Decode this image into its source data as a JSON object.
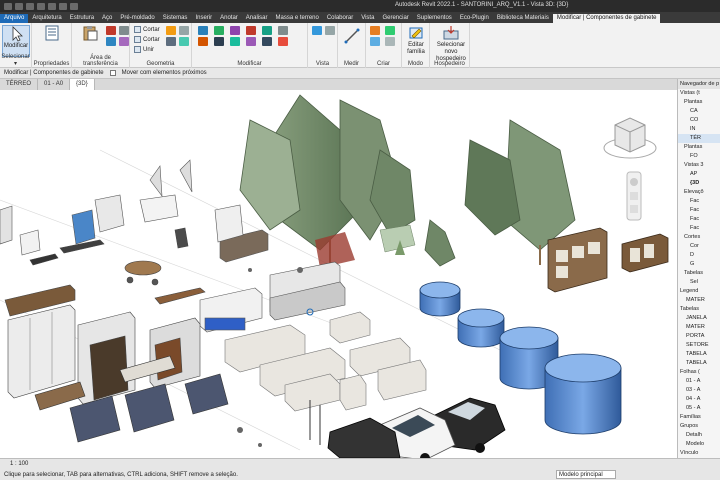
{
  "title": "Autodesk Revit 2022.1 - SANTORINI_ARQ_V1.1 - Vista 3D: {3D}",
  "ribbon_tabs": [
    "Arquivo",
    "Arquitetura",
    "Estrutura",
    "Aço",
    "Pré-moldado",
    "Sistemas",
    "Inserir",
    "Anotar",
    "Analisar",
    "Massa e terreno",
    "Colaborar",
    "Vista",
    "Gerenciar",
    "Suplementos",
    "Eco-Plugin",
    "Biblioteca Materiais",
    "Modificar | Componentes de gabinete"
  ],
  "ribbon": {
    "modify_label": "Modificar",
    "select_menu": "Selecionar ▾",
    "properties_label": "Propriedades",
    "clipboard_label": "Área de transferência",
    "cut_label": "Cortar",
    "join_label": "Unir",
    "panel_labels": {
      "geometry": "Geometria",
      "modify": "Modificar",
      "view": "Vista",
      "measure": "Medir",
      "create": "Criar",
      "mode": "Modo",
      "host": "Hospedeiro"
    },
    "edit_family": "Editar família",
    "pick_new_host": "Selecionar novo hospedeiro"
  },
  "options_bar": {
    "context": "Modificar | Componentes de gabinete",
    "checkbox_label": "Mover com elementos próximos"
  },
  "view_tabs": [
    "TÉRREO",
    "01 - A0",
    "{3D}"
  ],
  "active_view_tab": "{3D}",
  "browser": {
    "header": "Navegador de p",
    "rows": [
      "Vistas (t",
      "Plantas",
      "CA",
      "CO",
      "IN",
      "TÉR",
      "Plantas",
      "FO",
      "Vistas 3",
      "AP",
      "{3D",
      "Elevaçõ",
      "Fac",
      "Fac",
      "Fac",
      "Fac",
      "Cortes",
      "Cor",
      "D",
      "G",
      "Tabelas",
      "Sel",
      "Legend",
      "MATER",
      "Tabelas",
      "JANELA",
      "MATER",
      "PORTA",
      "SETORE",
      "TABELA",
      "TABELA",
      "Folhas (",
      "01 - A",
      "03 - A",
      "04 - A",
      "05 - A",
      "Famílias",
      "Grupos",
      "Detalh",
      "Modelo",
      "Vínculo"
    ]
  },
  "status": {
    "scale": "1 : 100",
    "message": "Clique para selecionar, TAB para alternativas, CTRL adiciona, SHIFT remove a seleção.",
    "model": "Modelo principal"
  },
  "colors": {
    "accent": "#1e6bb8",
    "ribbon_bg": "#f2f2f2",
    "tabbar_bg": "#3a3a3a",
    "tree_green": "#6f8767",
    "tank_blue": "#5b8fd4"
  }
}
